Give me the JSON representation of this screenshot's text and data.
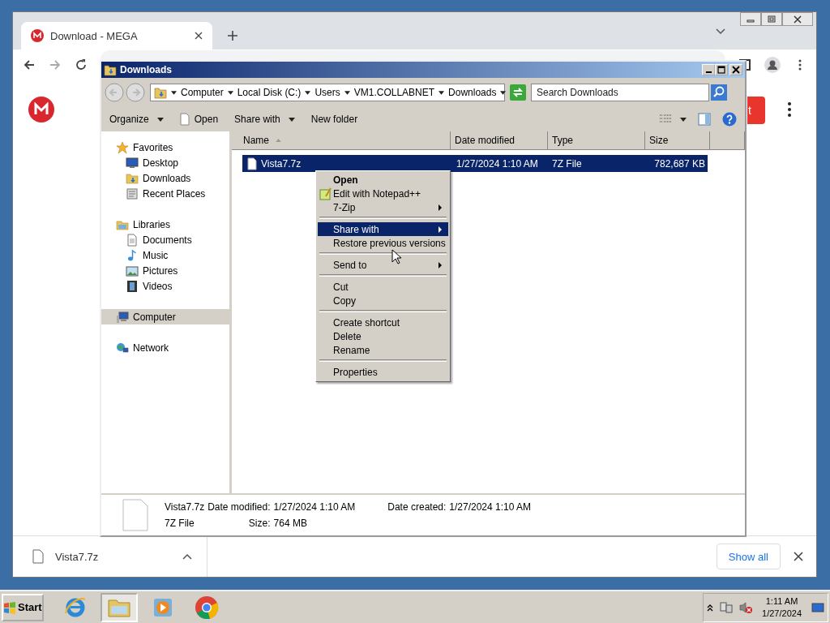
{
  "browser": {
    "tab": {
      "title": "Download - MEGA",
      "selected": true
    },
    "page_button": "t",
    "download_shelf": {
      "file": "Vista7.7z",
      "show_all": "Show all"
    }
  },
  "explorer": {
    "title": "Downloads",
    "breadcrumb": [
      "Computer",
      "Local Disk (C:)",
      "Users",
      "VM1.COLLABNET",
      "Downloads"
    ],
    "search": {
      "placeholder": "Search Downloads"
    },
    "toolbar": [
      {
        "label": "Organize",
        "dropdown": true,
        "kind": "menu"
      },
      {
        "label": "Open",
        "dropdown": false,
        "kind": "file"
      },
      {
        "label": "Share with",
        "dropdown": true,
        "kind": "menu"
      },
      {
        "label": "New folder",
        "dropdown": false,
        "kind": "menu"
      }
    ],
    "nav": [
      {
        "label": "Favorites",
        "kind": "star",
        "selected": false,
        "children": [
          {
            "label": "Desktop",
            "kind": "desktop",
            "selected": false
          },
          {
            "label": "Downloads",
            "kind": "downloads",
            "selected": false
          },
          {
            "label": "Recent Places",
            "kind": "recent",
            "selected": false
          }
        ]
      },
      {
        "label": "Libraries",
        "kind": "library",
        "selected": false,
        "children": [
          {
            "label": "Documents",
            "kind": "document",
            "selected": false
          },
          {
            "label": "Music",
            "kind": "music",
            "selected": false
          },
          {
            "label": "Pictures",
            "kind": "picture",
            "selected": false
          },
          {
            "label": "Videos",
            "kind": "video",
            "selected": false
          }
        ]
      },
      {
        "label": "Computer",
        "kind": "computer",
        "selected": true
      },
      {
        "label": "Network",
        "kind": "network",
        "selected": false
      }
    ],
    "columns": [
      {
        "label": "Name",
        "sorted": true
      },
      {
        "label": "Date modified",
        "sorted": false
      },
      {
        "label": "Type",
        "sorted": false
      },
      {
        "label": "Size",
        "sorted": false
      }
    ],
    "files": [
      {
        "name": "Vista7.7z",
        "date_modified": "1/27/2024 1:10 AM",
        "type": "7Z File",
        "size": "782,687 KB",
        "selected": true
      }
    ],
    "details": {
      "name": "Vista7.7z",
      "type": "7Z File",
      "date_modified_label": "Date modified:",
      "date_modified": "1/27/2024 1:10 AM",
      "date_created_label": "Date created:",
      "date_created": "1/27/2024 1:10 AM",
      "size_label": "Size:",
      "size": "764 MB"
    }
  },
  "context_menu": [
    {
      "kind": "item",
      "label": "Open",
      "bold": true,
      "submenu": false,
      "selected": false,
      "icon": false
    },
    {
      "kind": "item",
      "label": "Edit with Notepad++",
      "bold": false,
      "submenu": false,
      "selected": false,
      "icon": true
    },
    {
      "kind": "item",
      "label": "7-Zip",
      "bold": false,
      "submenu": true,
      "selected": false,
      "icon": false
    },
    {
      "kind": "separator"
    },
    {
      "kind": "item",
      "label": "Share with",
      "bold": false,
      "submenu": true,
      "selected": true,
      "icon": false
    },
    {
      "kind": "item",
      "label": "Restore previous versions",
      "bold": false,
      "submenu": false,
      "selected": false,
      "icon": false
    },
    {
      "kind": "separator"
    },
    {
      "kind": "item",
      "label": "Send to",
      "bold": false,
      "submenu": true,
      "selected": false,
      "icon": false
    },
    {
      "kind": "separator"
    },
    {
      "kind": "item",
      "label": "Cut",
      "bold": false,
      "submenu": false,
      "selected": false,
      "icon": false
    },
    {
      "kind": "item",
      "label": "Copy",
      "bold": false,
      "submenu": false,
      "selected": false,
      "icon": false
    },
    {
      "kind": "separator"
    },
    {
      "kind": "item",
      "label": "Create shortcut",
      "bold": false,
      "submenu": false,
      "selected": false,
      "icon": false
    },
    {
      "kind": "item",
      "label": "Delete",
      "bold": false,
      "submenu": false,
      "selected": false,
      "icon": false
    },
    {
      "kind": "item",
      "label": "Rename",
      "bold": false,
      "submenu": false,
      "selected": false,
      "icon": false
    },
    {
      "kind": "separator"
    },
    {
      "kind": "item",
      "label": "Properties",
      "bold": false,
      "submenu": false,
      "selected": false,
      "icon": false
    }
  ],
  "taskbar": {
    "start": "Start",
    "apps": [
      {
        "kind": "ie",
        "selected": false
      },
      {
        "kind": "explorer",
        "selected": true
      },
      {
        "kind": "media",
        "selected": false
      },
      {
        "kind": "chrome",
        "selected": false
      }
    ],
    "clock": {
      "time": "1:11 AM",
      "date": "1/27/2024"
    }
  }
}
